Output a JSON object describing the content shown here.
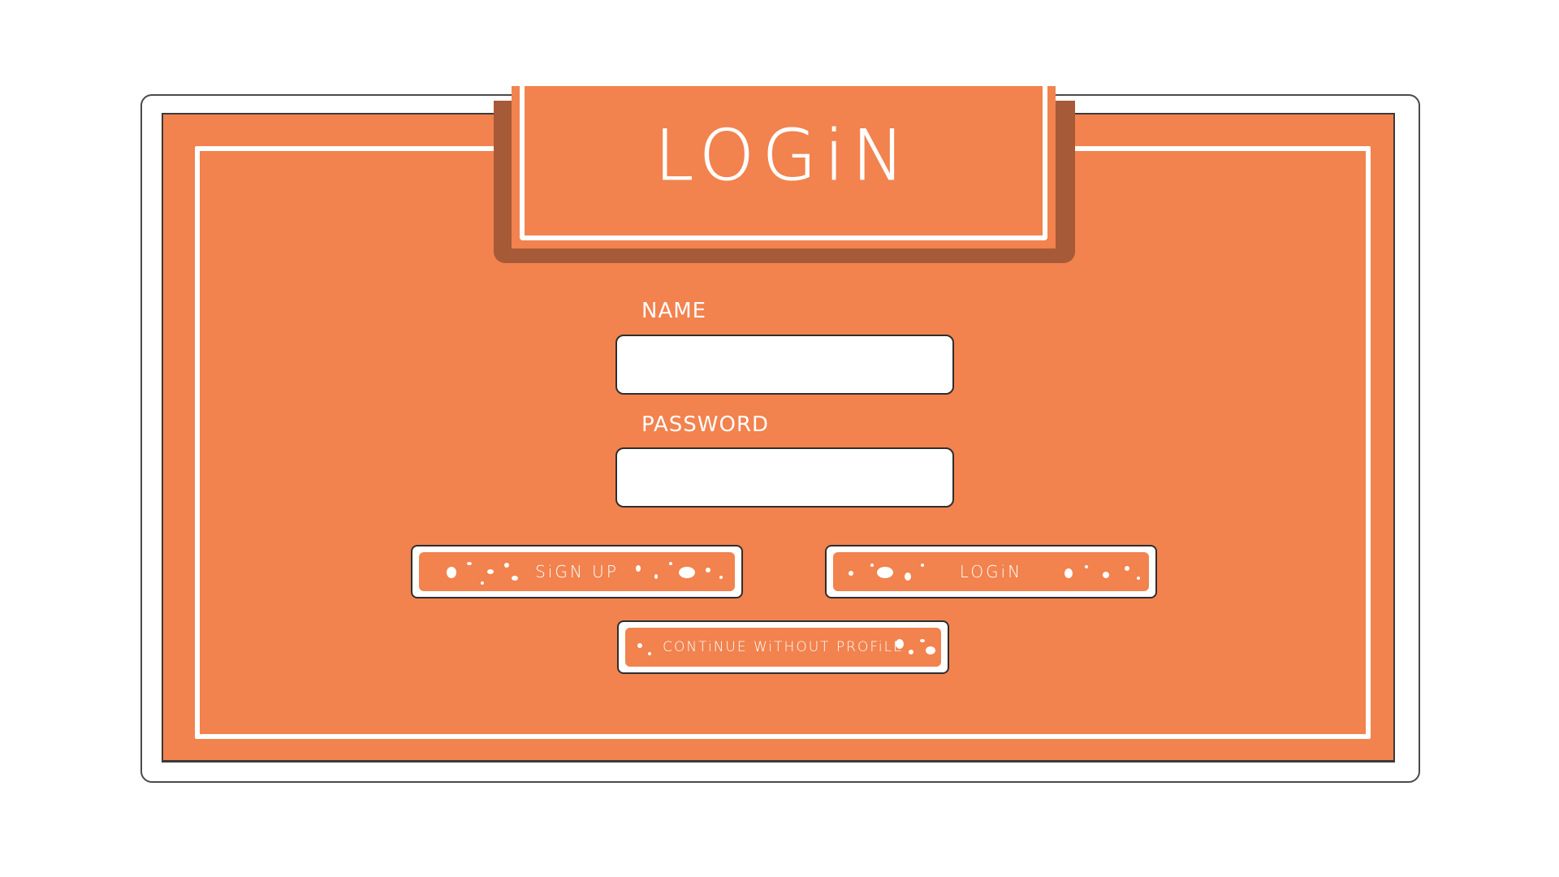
{
  "title": "LOGiN",
  "form": {
    "name_label": "NAME",
    "name_value": "",
    "password_label": "PASSWORD",
    "password_value": ""
  },
  "buttons": {
    "signup_label": "SiGN UP",
    "login_label": "LOGiN",
    "guest_label": "CONTiNUE WiTHOUT PROFiLE"
  },
  "colors": {
    "panel": "#f2824e",
    "tab_shadow": "#a65a38",
    "line": "#ffffff"
  }
}
